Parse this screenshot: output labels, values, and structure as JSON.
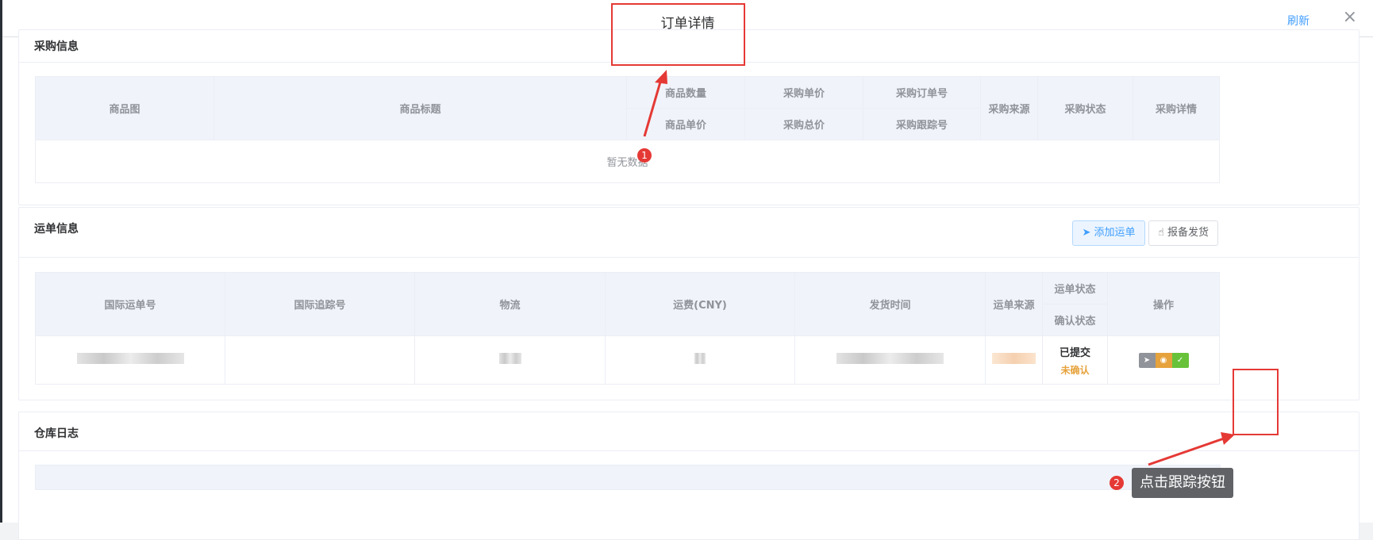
{
  "dialog": {
    "title": "订单详情",
    "refresh_label": "刷新",
    "close_glyph": "×"
  },
  "purchase": {
    "title": "采购信息",
    "headers": {
      "image": "商品图",
      "goods_title": "商品标题",
      "goods_qty": "商品数量",
      "goods_price": "商品单价",
      "unit_price": "采购单价",
      "total_price": "采购总价",
      "order_no": "采购订单号",
      "tracking_no": "采购跟踪号",
      "source": "采购来源",
      "status": "采购状态",
      "detail": "采购详情"
    },
    "empty_text": "暂无数据"
  },
  "waybill": {
    "title": "运单信息",
    "add_label": "添加运单",
    "report_label": "报备发货",
    "headers": {
      "intl_no": "国际运单号",
      "intl_track": "国际追踪号",
      "logistics": "物流",
      "fee": "运费(CNY)",
      "ship_time": "发货时间",
      "source": "运单来源",
      "waybill_status": "运单状态",
      "confirm_status": "确认状态",
      "actions": "操作"
    },
    "row": {
      "waybill_status": "已提交",
      "confirm_status": "未确认"
    },
    "colors": {
      "confirm_status": "#e6a23c",
      "op_track": "#909399",
      "op_view": "#e6a23c",
      "op_confirm": "#67c23a"
    }
  },
  "warehouse": {
    "title": "仓库日志"
  },
  "annotations": {
    "step1": "1",
    "step2": "2",
    "tooltip": "点击跟踪按钮"
  }
}
